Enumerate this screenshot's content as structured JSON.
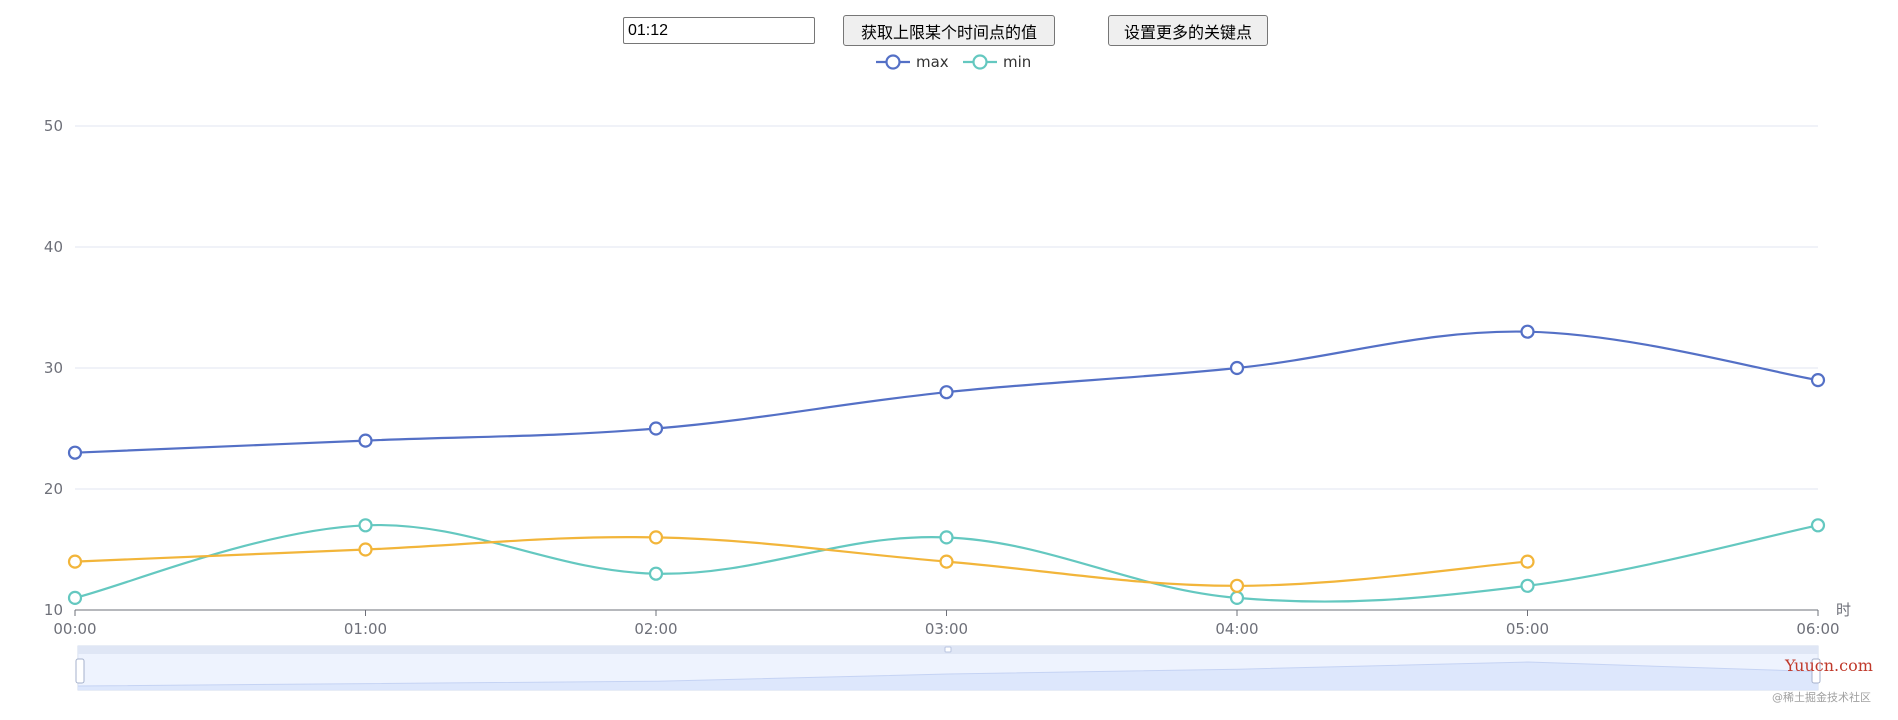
{
  "toolbar": {
    "time_input_value": "01:12",
    "get_value_button": "获取上限某个时间点的值",
    "more_keypoints_button": "设置更多的关键点"
  },
  "colors": {
    "max": "#5470c6",
    "min": "#73c0de",
    "min_line": "#64c8c0",
    "third": "#f2b53a",
    "grid": "#e0e6f1",
    "axis": "#6e7079",
    "zoom_fill": "#e8efff",
    "zoom_border": "#d2dbee",
    "zoom_area": "#c7d6f6",
    "zoom_line": "#9cb2e6"
  },
  "chart_data": {
    "type": "line",
    "smooth": true,
    "x": [
      "00:00",
      "01:00",
      "02:00",
      "03:00",
      "04:00",
      "05:00",
      "06:00"
    ],
    "xlabel": "时",
    "ylim": [
      10,
      50
    ],
    "yticks": [
      10,
      20,
      30,
      40,
      50
    ],
    "legend_position": "top-center",
    "grid": true,
    "series": [
      {
        "name": "max",
        "values": [
          23,
          24,
          25,
          28,
          30,
          33,
          29
        ],
        "color": "#5470c6"
      },
      {
        "name": "min",
        "values": [
          11,
          17,
          13,
          16,
          11,
          12,
          17
        ],
        "color": "#64c8c0"
      },
      {
        "values": [
          14,
          15,
          16,
          14,
          12,
          14
        ],
        "color": "#f2b53a"
      }
    ],
    "data_zoom": {
      "start": 0,
      "end": 100
    }
  },
  "watermark": {
    "site": "Yuucn.com",
    "credit": "@稀土掘金技术社区"
  }
}
